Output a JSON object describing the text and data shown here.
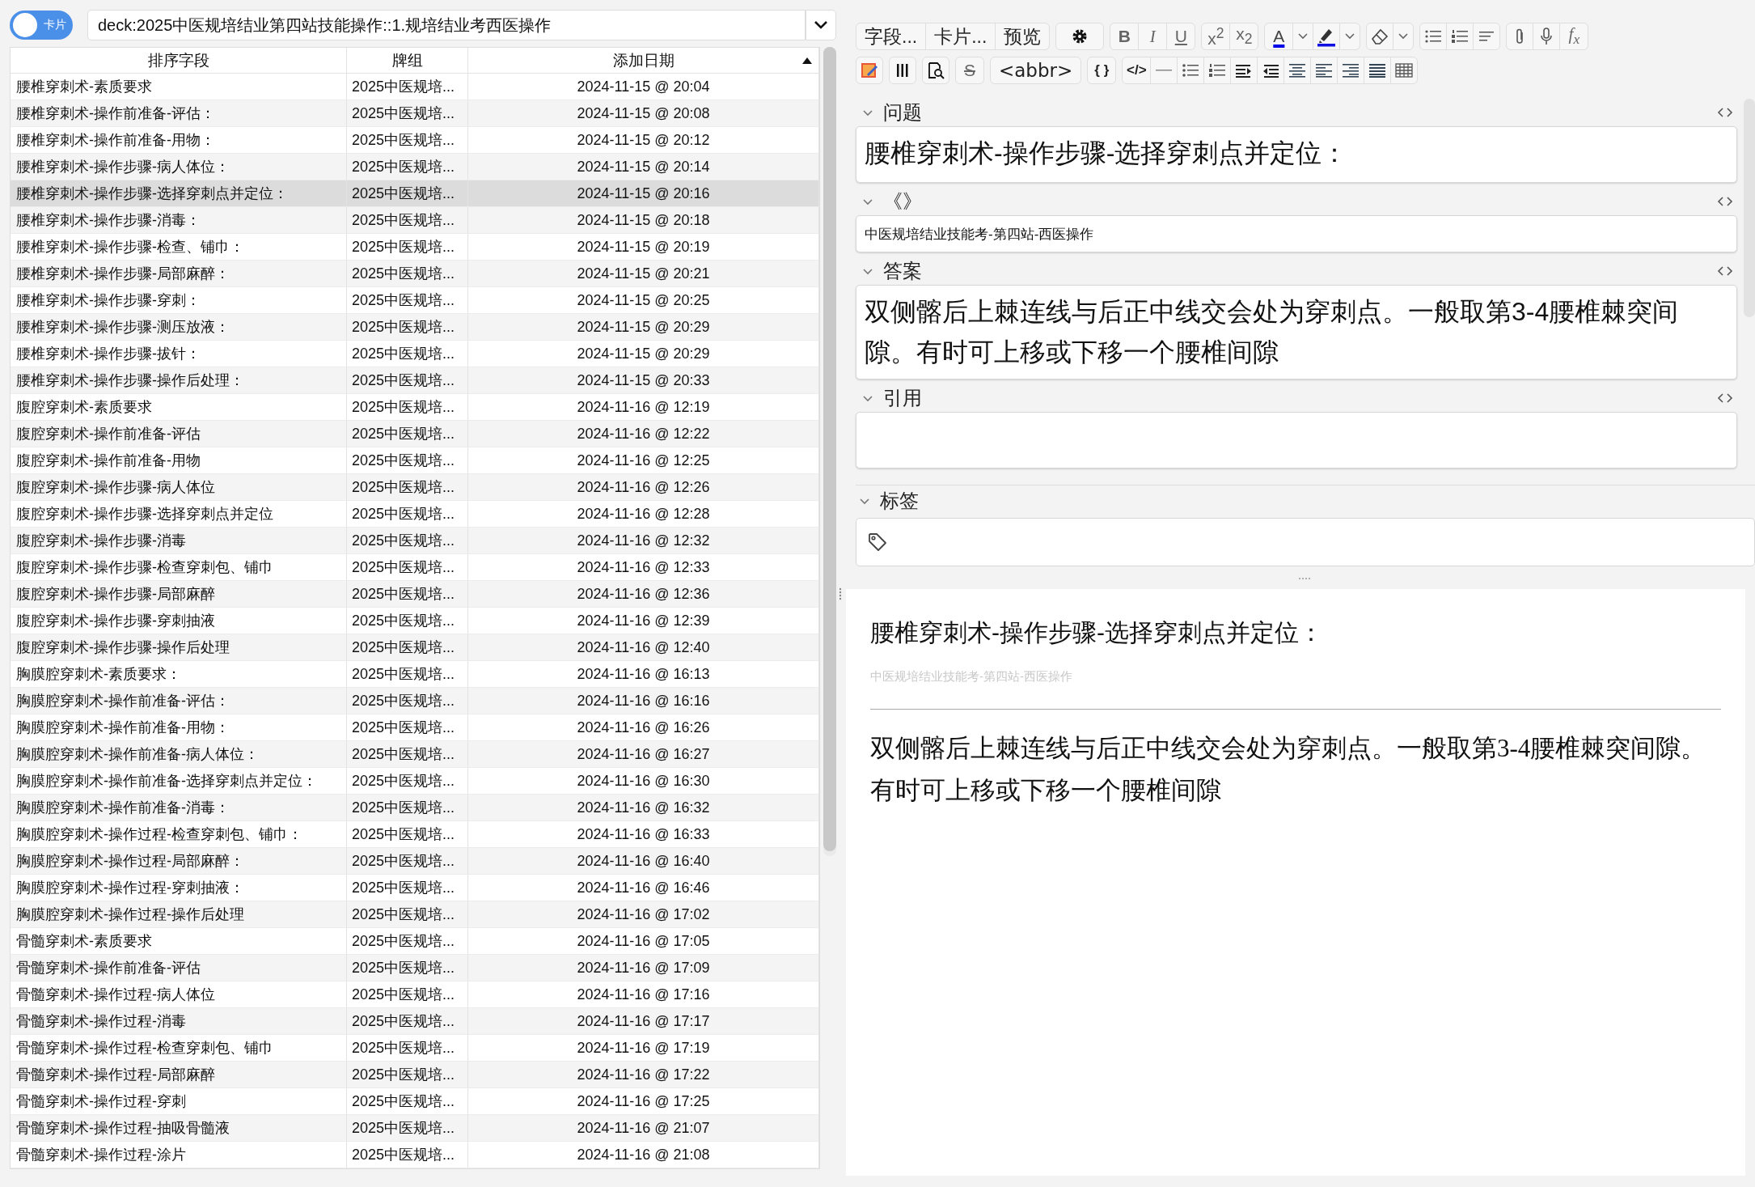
{
  "toggle": {
    "label": "卡片"
  },
  "search": {
    "value": "deck:2025中医规培结业第四站技能操作::1.规培结业考西医操作"
  },
  "table": {
    "columns": [
      {
        "label": "排序字段",
        "sorted": false
      },
      {
        "label": "牌组",
        "sorted": false
      },
      {
        "label": "添加日期",
        "sorted": true
      }
    ],
    "rows": [
      {
        "sort_field": "腰椎穿刺术-素质要求",
        "deck": "2025中医规培...",
        "date": "2024-11-15 @ 20:04",
        "selected": false
      },
      {
        "sort_field": "腰椎穿刺术-操作前准备-评估：",
        "deck": "2025中医规培...",
        "date": "2024-11-15 @ 20:08",
        "selected": false
      },
      {
        "sort_field": "腰椎穿刺术-操作前准备-用物：",
        "deck": "2025中医规培...",
        "date": "2024-11-15 @ 20:12",
        "selected": false
      },
      {
        "sort_field": "腰椎穿刺术-操作步骤-病人体位：",
        "deck": "2025中医规培...",
        "date": "2024-11-15 @ 20:14",
        "selected": false
      },
      {
        "sort_field": "腰椎穿刺术-操作步骤-选择穿刺点并定位：",
        "deck": "2025中医规培...",
        "date": "2024-11-15 @ 20:16",
        "selected": true
      },
      {
        "sort_field": "腰椎穿刺术-操作步骤-消毒：",
        "deck": "2025中医规培...",
        "date": "2024-11-15 @ 20:18",
        "selected": false
      },
      {
        "sort_field": "腰椎穿刺术-操作步骤-检查、铺巾：",
        "deck": "2025中医规培...",
        "date": "2024-11-15 @ 20:19",
        "selected": false
      },
      {
        "sort_field": "腰椎穿刺术-操作步骤-局部麻醉：",
        "deck": "2025中医规培...",
        "date": "2024-11-15 @ 20:21",
        "selected": false
      },
      {
        "sort_field": "腰椎穿刺术-操作步骤-穿刺：",
        "deck": "2025中医规培...",
        "date": "2024-11-15 @ 20:25",
        "selected": false
      },
      {
        "sort_field": "腰椎穿刺术-操作步骤-测压放液：",
        "deck": "2025中医规培...",
        "date": "2024-11-15 @ 20:29",
        "selected": false
      },
      {
        "sort_field": "腰椎穿刺术-操作步骤-拔针：",
        "deck": "2025中医规培...",
        "date": "2024-11-15 @ 20:29",
        "selected": false
      },
      {
        "sort_field": "腰椎穿刺术-操作步骤-操作后处理：",
        "deck": "2025中医规培...",
        "date": "2024-11-15 @ 20:33",
        "selected": false
      },
      {
        "sort_field": "腹腔穿刺术-素质要求",
        "deck": "2025中医规培...",
        "date": "2024-11-16 @ 12:19",
        "selected": false
      },
      {
        "sort_field": "腹腔穿刺术-操作前准备-评估",
        "deck": "2025中医规培...",
        "date": "2024-11-16 @ 12:22",
        "selected": false
      },
      {
        "sort_field": "腹腔穿刺术-操作前准备-用物",
        "deck": "2025中医规培...",
        "date": "2024-11-16 @ 12:25",
        "selected": false
      },
      {
        "sort_field": "腹腔穿刺术-操作步骤-病人体位",
        "deck": "2025中医规培...",
        "date": "2024-11-16 @ 12:26",
        "selected": false
      },
      {
        "sort_field": "腹腔穿刺术-操作步骤-选择穿刺点并定位",
        "deck": "2025中医规培...",
        "date": "2024-11-16 @ 12:28",
        "selected": false
      },
      {
        "sort_field": "腹腔穿刺术-操作步骤-消毒",
        "deck": "2025中医规培...",
        "date": "2024-11-16 @ 12:32",
        "selected": false
      },
      {
        "sort_field": "腹腔穿刺术-操作步骤-检查穿刺包、铺巾",
        "deck": "2025中医规培...",
        "date": "2024-11-16 @ 12:33",
        "selected": false
      },
      {
        "sort_field": "腹腔穿刺术-操作步骤-局部麻醉",
        "deck": "2025中医规培...",
        "date": "2024-11-16 @ 12:36",
        "selected": false
      },
      {
        "sort_field": "腹腔穿刺术-操作步骤-穿刺抽液",
        "deck": "2025中医规培...",
        "date": "2024-11-16 @ 12:39",
        "selected": false
      },
      {
        "sort_field": "腹腔穿刺术-操作步骤-操作后处理",
        "deck": "2025中医规培...",
        "date": "2024-11-16 @ 12:40",
        "selected": false
      },
      {
        "sort_field": "胸膜腔穿刺术-素质要求：",
        "deck": "2025中医规培...",
        "date": "2024-11-16 @ 16:13",
        "selected": false
      },
      {
        "sort_field": "胸膜腔穿刺术-操作前准备-评估：",
        "deck": "2025中医规培...",
        "date": "2024-11-16 @ 16:16",
        "selected": false
      },
      {
        "sort_field": "胸膜腔穿刺术-操作前准备-用物：",
        "deck": "2025中医规培...",
        "date": "2024-11-16 @ 16:26",
        "selected": false
      },
      {
        "sort_field": "胸膜腔穿刺术-操作前准备-病人体位：",
        "deck": "2025中医规培...",
        "date": "2024-11-16 @ 16:27",
        "selected": false
      },
      {
        "sort_field": "胸膜腔穿刺术-操作前准备-选择穿刺点并定位：",
        "deck": "2025中医规培...",
        "date": "2024-11-16 @ 16:30",
        "selected": false
      },
      {
        "sort_field": "胸膜腔穿刺术-操作前准备-消毒：",
        "deck": "2025中医规培...",
        "date": "2024-11-16 @ 16:32",
        "selected": false
      },
      {
        "sort_field": "胸膜腔穿刺术-操作过程-检查穿刺包、铺巾：",
        "deck": "2025中医规培...",
        "date": "2024-11-16 @ 16:33",
        "selected": false
      },
      {
        "sort_field": "胸膜腔穿刺术-操作过程-局部麻醉：",
        "deck": "2025中医规培...",
        "date": "2024-11-16 @ 16:40",
        "selected": false
      },
      {
        "sort_field": "胸膜腔穿刺术-操作过程-穿刺抽液：",
        "deck": "2025中医规培...",
        "date": "2024-11-16 @ 16:46",
        "selected": false
      },
      {
        "sort_field": "胸膜腔穿刺术-操作过程-操作后处理",
        "deck": "2025中医规培...",
        "date": "2024-11-16 @ 17:02",
        "selected": false
      },
      {
        "sort_field": "骨髓穿刺术-素质要求",
        "deck": "2025中医规培...",
        "date": "2024-11-16 @ 17:05",
        "selected": false
      },
      {
        "sort_field": "骨髓穿刺术-操作前准备-评估",
        "deck": "2025中医规培...",
        "date": "2024-11-16 @ 17:09",
        "selected": false
      },
      {
        "sort_field": "骨髓穿刺术-操作过程-病人体位",
        "deck": "2025中医规培...",
        "date": "2024-11-16 @ 17:16",
        "selected": false
      },
      {
        "sort_field": "骨髓穿刺术-操作过程-消毒",
        "deck": "2025中医规培...",
        "date": "2024-11-16 @ 17:17",
        "selected": false
      },
      {
        "sort_field": "骨髓穿刺术-操作过程-检查穿刺包、铺巾",
        "deck": "2025中医规培...",
        "date": "2024-11-16 @ 17:19",
        "selected": false
      },
      {
        "sort_field": "骨髓穿刺术-操作过程-局部麻醉",
        "deck": "2025中医规培...",
        "date": "2024-11-16 @ 17:22",
        "selected": false
      },
      {
        "sort_field": "骨髓穿刺术-操作过程-穿刺",
        "deck": "2025中医规培...",
        "date": "2024-11-16 @ 17:25",
        "selected": false
      },
      {
        "sort_field": "骨髓穿刺术-操作过程-抽吸骨髓液",
        "deck": "2025中医规培...",
        "date": "2024-11-16 @ 21:07",
        "selected": false
      },
      {
        "sort_field": "骨髓穿刺术-操作过程-涂片",
        "deck": "2025中医规培...",
        "date": "2024-11-16 @ 21:08",
        "selected": false
      }
    ]
  },
  "toolbar": {
    "note_buttons": [
      "字段...",
      "卡片...",
      "预览"
    ],
    "format_buttons": [
      {
        "label": "B",
        "kind": "bold"
      },
      {
        "label": "I",
        "kind": "italic"
      },
      {
        "label": "U",
        "kind": "underline"
      }
    ],
    "script_buttons": [
      "x$^{2}$",
      "x$_{2}$"
    ],
    "text_color_label": "A",
    "math_label": "f$_{x}$",
    "strike_label": "S",
    "abbr_label": "<abbr>",
    "cloze_label": "{ }",
    "html_label": "</>"
  },
  "fields": [
    {
      "label": "问题",
      "expanded": true,
      "kind": "large",
      "value": "腰椎穿刺术-操作步骤-选择穿刺点并定位："
    },
    {
      "label": "《》",
      "expanded": true,
      "kind": "small",
      "value": "中医规培结业技能考-第四站-西医操作"
    },
    {
      "label": "答案",
      "expanded": true,
      "kind": "large",
      "value": "双侧髂后上棘连线与后正中线交会处为穿刺点。一般取第3-4腰椎棘突间隙。有时可上移或下移一个腰椎间隙"
    },
    {
      "label": "引用",
      "expanded": true,
      "kind": "large"
    }
  ],
  "tags": {
    "label": "标签",
    "expanded": true
  },
  "preview": {
    "question": "腰椎穿刺术-操作步骤-选择穿刺点并定位：",
    "source": "中医规培结业技能考-第四站-西医操作",
    "answer": "双侧髂后上棘连线与后正中线交会处为穿刺点。一般取第3-4腰椎棘突间隙。有时可上移或下移一个腰椎间隙"
  }
}
